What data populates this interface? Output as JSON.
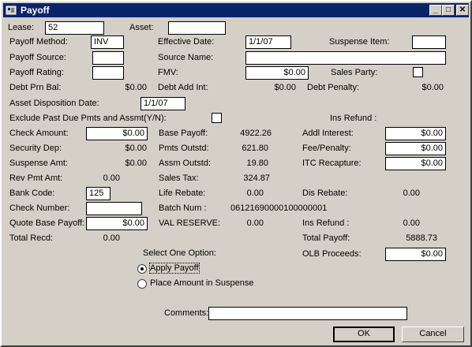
{
  "window": {
    "title": "Payoff",
    "icon": "app-icon",
    "buttons": [
      "minimize-icon",
      "maximize-icon",
      "close-icon"
    ]
  },
  "fields": {
    "lease_label": "Lease:",
    "lease_value": "52",
    "asset_label": "Asset:",
    "asset_value": "",
    "payoff_method_label": "Payoff Method:",
    "payoff_method_value": "INV",
    "effective_date_label": "Effective Date:",
    "effective_date_value": "1/1/07",
    "suspense_item_label": "Suspense Item:",
    "suspense_item_value": "",
    "payoff_source_label": "Payoff Source:",
    "payoff_source_value": "",
    "source_name_label": "Source Name:",
    "source_name_value": "",
    "payoff_rating_label": "Payoff Rating:",
    "payoff_rating_value": "",
    "fmv_label": "FMV:",
    "fmv_value": "$0.00",
    "sales_party_label": "Sales Party:",
    "debt_prn_bal_label": "Debt Prn Bal:",
    "debt_prn_bal_value": "$0.00",
    "debt_add_int_label": "Debt Add Int:",
    "debt_add_int_value": "$0.00",
    "debt_penalty_label": "Debt Penalty:",
    "debt_penalty_value": "$0.00",
    "asset_disposition_label": "Asset Disposition Date:",
    "asset_disposition_value": "1/1/07",
    "exclude_label": "Exclude Past Due Pmts and Assmt(Y/N):",
    "ins_refund_top_label": "Ins Refund   :",
    "check_amount_label": "Check Amount:",
    "check_amount_value": "$0.00",
    "base_payoff_label": "Base Payoff:",
    "base_payoff_value": "4922.26",
    "addl_interest_label": "Addl Interest:",
    "addl_interest_value": "$0.00",
    "security_dep_label": "Security Dep:",
    "security_dep_value": "$0.00",
    "pmts_outstd_label": "Pmts Outstd:",
    "pmts_outstd_value": "621.80",
    "fee_penalty_label": "Fee/Penalty:",
    "fee_penalty_value": "$0.00",
    "suspense_amt_label": "Suspense Amt:",
    "suspense_amt_value": "$0.00",
    "assm_outstd_label": "Assm Outstd:",
    "assm_outstd_value": "19.80",
    "itc_recapture_label": "ITC Recapture:",
    "itc_recapture_value": "$0.00",
    "rev_pmt_amt_label": "Rev Pmt Amt:",
    "rev_pmt_amt_value": "0.00",
    "sales_tax_label": "Sales Tax:",
    "sales_tax_value": "324.87",
    "bank_code_label": "Bank Code:",
    "bank_code_value": "125",
    "life_rebate_label": "Life Rebate:",
    "life_rebate_value": "0.00",
    "dis_rebate_label": "Dis Rebate:",
    "dis_rebate_value": "0.00",
    "check_number_label": "Check Number:",
    "check_number_value": "",
    "batch_num_label": "Batch Num   :",
    "batch_num_value": "06121690000100000001",
    "quote_base_payoff_label": "Quote Base Payoff:",
    "quote_base_payoff_value": "$0.00",
    "val_reserve_label": "VAL RESERVE:",
    "val_reserve_value": "0.00",
    "ins_refund_label": "Ins Refund   :",
    "ins_refund_value": "0.00",
    "total_recd_label": "Total Recd:",
    "total_recd_value": "0.00",
    "total_payoff_label": "Total Payoff:",
    "total_payoff_value": "5888.73",
    "olb_proceeds_label": "OLB Proceeds:",
    "olb_proceeds_value": "$0.00"
  },
  "options": {
    "label": "Select One Option:",
    "apply_payoff": "Apply Payoff",
    "place_in_suspense": "Place Amount in Suspense",
    "selected": "apply_payoff"
  },
  "comments": {
    "label": "Comments:",
    "value": ""
  },
  "buttons": {
    "ok": "OK",
    "cancel": "Cancel"
  },
  "colors": {
    "titlebar": "#0a246a",
    "face": "#d4d0c8"
  }
}
